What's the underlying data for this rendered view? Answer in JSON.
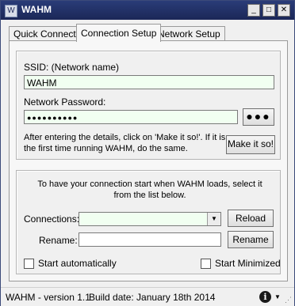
{
  "window": {
    "title": "WAHM",
    "app_icon_glyph": "W"
  },
  "titlebar_buttons": {
    "minimize": "_",
    "maximize": "□",
    "close": "✕"
  },
  "tabs": [
    {
      "label": "Quick Connect",
      "active": false
    },
    {
      "label": "Connection Setup",
      "active": true
    },
    {
      "label": "Network Setup",
      "active": false
    }
  ],
  "connection": {
    "ssid_label": "SSID: (Network name)",
    "ssid_value": "WAHM",
    "password_label": "Network Password:",
    "password_value": "●●●●●●●●●●",
    "show_password_button": "●●●",
    "instructions": "After entering the details, click on 'Make it so!'. If it is the first time running WAHM, do the same.",
    "make_it_so_button": "Make it so!"
  },
  "startup": {
    "description": "To have your connection start when WAHM loads, select it from the list below.",
    "connections_label": "Connections:",
    "connections_value": "",
    "reload_button": "Reload",
    "rename_label": "Rename:",
    "rename_value": "",
    "rename_button": "Rename",
    "start_auto_label": "Start automatically",
    "start_minimized_label": "Start Minimized"
  },
  "status": {
    "version_text": "WAHM - version 1.1",
    "build_date_text": "Build date: January 18th 2014"
  },
  "colors": {
    "titlebar": "#1b2757",
    "field_bg": "#f1fff1"
  },
  "icons": [
    "app-icon",
    "info-icon",
    "dropdown-arrow-icon",
    "resize-grip-icon"
  ]
}
